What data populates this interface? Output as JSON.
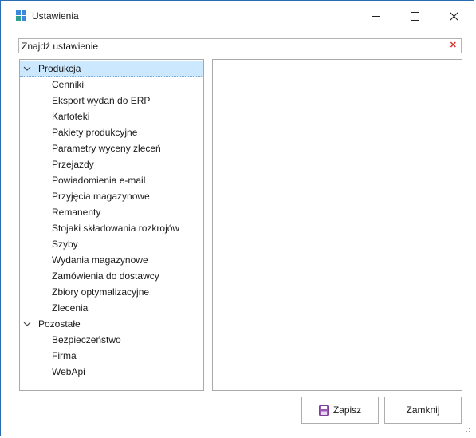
{
  "window": {
    "title": "Ustawienia",
    "accent": "#2b6cb0",
    "icon": "settings-app-icon"
  },
  "search": {
    "value": "Znajdź ustawienie",
    "clear_icon": "close-icon",
    "clear_color": "#d9302b"
  },
  "tree": {
    "selected_color": "#cce8ff",
    "categories": [
      {
        "label": "Produkcja",
        "expanded": true,
        "selected": true,
        "items": [
          "Cenniki",
          "Eksport wydań do ERP",
          "Kartoteki",
          "Pakiety produkcyjne",
          "Parametry wyceny zleceń",
          "Przejazdy",
          "Powiadomienia e-mail",
          "Przyjęcia magazynowe",
          "Remanenty",
          "Stojaki składowania rozkrojów",
          "Szyby",
          "Wydania magazynowe",
          "Zamówienia do dostawcy",
          "Zbiory optymalizacyjne",
          "Zlecenia"
        ]
      },
      {
        "label": "Pozostałe",
        "expanded": true,
        "selected": false,
        "items": [
          "Bezpieczeństwo",
          "Firma",
          "WebApi"
        ]
      }
    ]
  },
  "buttons": {
    "save_label": "Zapisz",
    "save_icon": "floppy-disk-icon",
    "close_label": "Zamknij"
  }
}
